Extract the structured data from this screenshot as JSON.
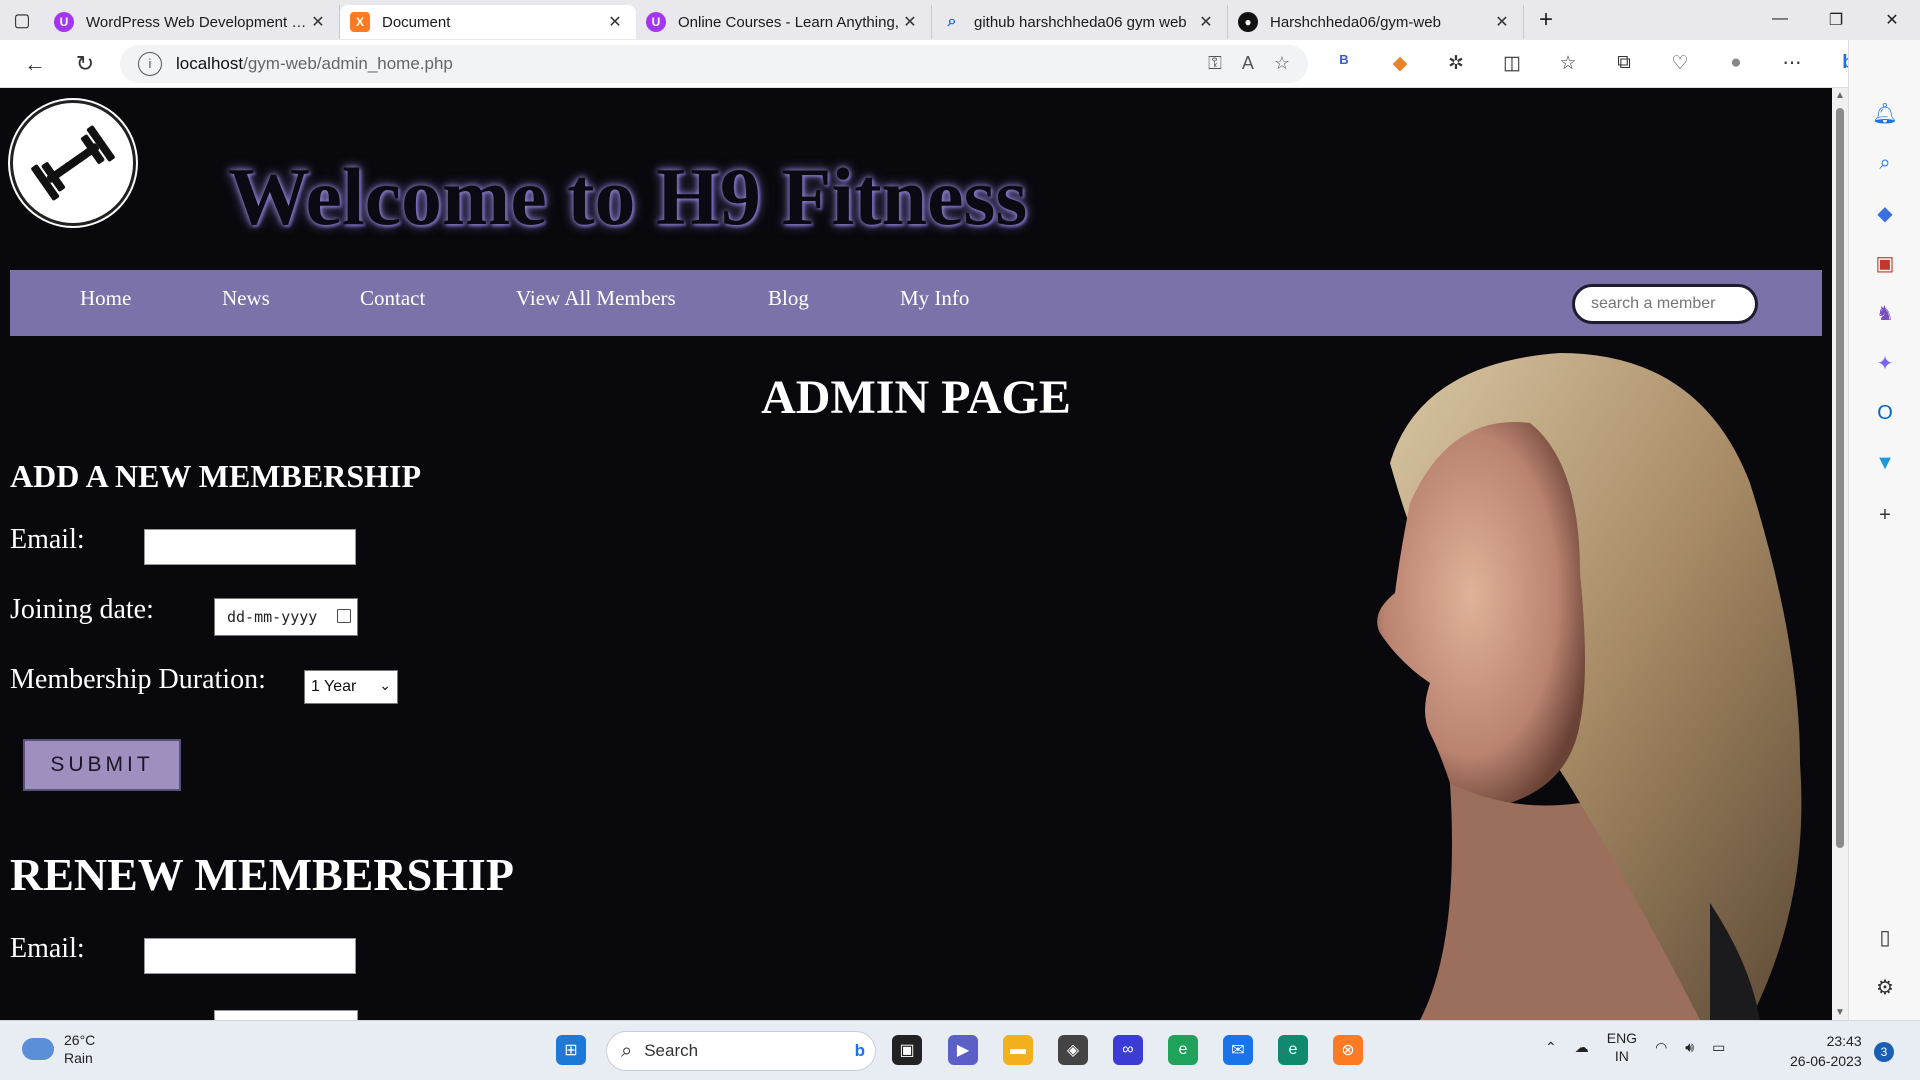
{
  "browser": {
    "tabs": [
      {
        "title": "WordPress Web Development Co",
        "favicon": "udemy-icon",
        "color": "#a435f0"
      },
      {
        "title": "Document",
        "favicon": "xampp-icon",
        "color": "#fb7a24"
      },
      {
        "title": "Online Courses - Learn Anything,",
        "favicon": "udemy-icon",
        "color": "#a435f0"
      },
      {
        "title": "github harshchheda06 gym web",
        "favicon": "search-icon",
        "color": "#1a73e8"
      },
      {
        "title": "Harshchheda06/gym-web",
        "favicon": "github-icon",
        "color": "#111111"
      }
    ],
    "active_tab": 1,
    "url_host": "localhost",
    "url_path": "/gym-web/admin_home.php"
  },
  "page": {
    "site_title": "Welcome to H9 Fitness",
    "nav": [
      "Home",
      "News",
      "Contact",
      "View All Members",
      "Blog",
      "My Info"
    ],
    "search_placeholder": "search a member",
    "admin_heading": "ADMIN PAGE",
    "add_section": {
      "heading": "ADD A NEW MEMBERSHIP",
      "email_label": "Email:",
      "joining_label": "Joining date:",
      "date_placeholder": "dd-mm-yyyy",
      "duration_label": "Membership Duration:",
      "duration_value": "1 Year",
      "submit_label": "SUBMIT"
    },
    "renew_section": {
      "heading": "RENEW MEMBERSHIP",
      "email_label": "Email:"
    }
  },
  "taskbar": {
    "weather_temp": "26°C",
    "weather_desc": "Rain",
    "search_label": "Search",
    "lang_line1": "ENG",
    "lang_line2": "IN",
    "time": "23:43",
    "date": "26-06-2023",
    "notification_count": "3"
  },
  "colors": {
    "nav_bar": "#7a72a9",
    "submit_button": "#9f8fbe",
    "page_background": "#09080c"
  }
}
